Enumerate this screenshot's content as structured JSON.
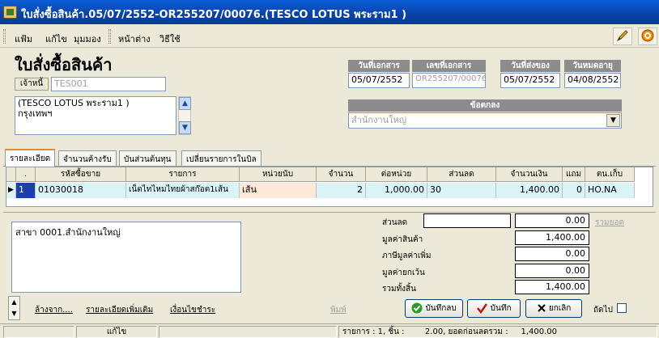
{
  "window": {
    "title": "ใบสั่งซื้อสินค้า.05/07/2552-OR255207/00076.(TESCO LOTUS พระราม1 )"
  },
  "menu": {
    "items": [
      "แฟ้ม",
      "แก้ไข",
      "มุมมอง",
      "หน้าต่าง",
      "วิธีใช้"
    ]
  },
  "header": {
    "heading": "ใบสั่งซื้อสินค้า",
    "creditor_label": "เจ้าหนี้",
    "creditor_code": "TES001",
    "address": [
      "(TESCO LOTUS พระราม1 )",
      "กรุงเทพฯ"
    ],
    "doc_date_label": "วันที่เอกสาร",
    "doc_date": "05/07/2552",
    "doc_no_label": "เลขที่เอกสาร",
    "doc_no": "OR255207/00076",
    "ship_date_label": "วันที่ส่งของ",
    "ship_date": "05/07/2552",
    "expiry_label": "วันหมดอายุ",
    "expiry_date": "04/08/2552",
    "terms_label": "ข้อตกลง",
    "terms_value": "สำนักงานใหญ่"
  },
  "tabs": [
    "รายละเอียด",
    "จำนวนค้างรับ",
    "บันส่วนต้นทุน",
    "เปลี่ยนรายการในบิล"
  ],
  "grid": {
    "columns": [
      ".",
      "รหัสซื้อขาย",
      "รายการ",
      "หน่วยนับ",
      "จำนวน",
      "ต่อหน่วย",
      "ส่วนลด",
      "จำนวนเงิน",
      "แถม",
      "ตน.เก็บ"
    ],
    "rows": [
      {
        "no": "1",
        "code": "01030018",
        "item": "เน็ตไทไหมไทยผ้าสก๊อต1เส้น",
        "unit": "เส้น",
        "qty": "2",
        "unit_price": "1,000.00",
        "discount": "30",
        "amount": "1,400.00",
        "free": "0",
        "location": "HO.NA"
      }
    ]
  },
  "memo": "สาขา 0001.สำนักงานใหญ่",
  "totals": {
    "discount_label": "ส่วนลด",
    "discount_text": "",
    "discount_value": "0.00",
    "sum_discount_link": "รวมยอด",
    "goods_label": "มูลค่าสินค้า",
    "goods_value": "1,400.00",
    "vat_label": "ภาษีมูลค่าเพิ่ม",
    "vat_value": "0.00",
    "exempt_label": "มูลค่ายกเว้น",
    "exempt_value": "0.00",
    "total_label": "รวมทั้งสิ้น",
    "total_value": "1,400.00"
  },
  "links": {
    "clear": "ล้างจาก....",
    "more_detail": "รายละเอียดเพิ่มเติม",
    "payment": "เงื่อนไขชำระ"
  },
  "buttons": {
    "print": "พิมพ์",
    "save_copy": "บันทึกลบ",
    "save": "บันทึก",
    "cancel": "ยกเลิก",
    "next_label": "ถัดไป"
  },
  "statusbar": {
    "mode": "แก้ไข",
    "summary": "รายการ : 1, ชิ้น :        2.00, ยอดก่อนลดรวม :     1,400.00"
  },
  "colors": {
    "title_bar": "#0842a8",
    "grid_selected_code": "#1c3fb0",
    "row_highlight": "#d9f3f7",
    "unit_highlight": "#fde9d9",
    "save_check": "#2a9a2a",
    "cancel_x": "#000000"
  },
  "icons": [
    "app-icon",
    "pen-icon",
    "target-icon",
    "scroll-up-icon",
    "scroll-down-icon",
    "combo-arrow-icon",
    "row-pointer-icon",
    "check-icon",
    "red-check-icon",
    "x-icon",
    "spin-up-icon",
    "spin-down-icon"
  ]
}
